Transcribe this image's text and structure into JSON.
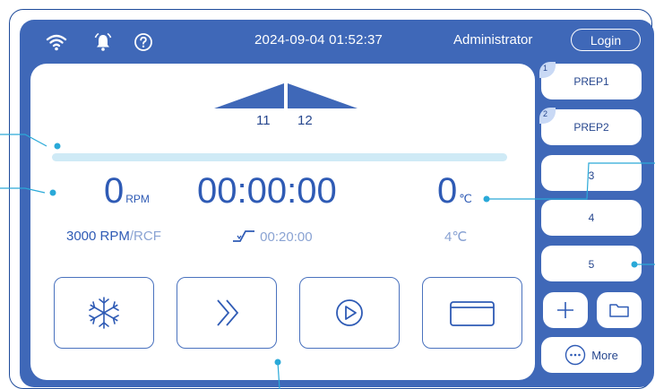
{
  "colors": {
    "screen_bg": "#3f68b8",
    "panel_bg": "#ffffff",
    "accent_blue": "#2f5bb5",
    "progress_track": "#cfeaf6",
    "annotation_line": "#2aa9d8"
  },
  "status_bar": {
    "icons": [
      "wifi-icon",
      "bell-icon",
      "help-icon"
    ],
    "datetime": "2024-09-04 01:52:37",
    "user": "Administrator",
    "login_label": "Login"
  },
  "rotor": {
    "left_slot": "11",
    "right_slot": "12"
  },
  "progress": {
    "fraction": 0.0
  },
  "readouts": {
    "speed_value": "0",
    "speed_unit": "RPM",
    "time_value": "00:00:00",
    "temp_value": "0",
    "temp_unit": "℃",
    "speed_setpoint": "3000 RPM",
    "speed_mode": "/RCF",
    "time_setpoint": "00:20:00",
    "temp_setpoint": "4℃"
  },
  "controls": [
    {
      "icon": "snowflake-icon"
    },
    {
      "icon": "fast-forward-icon"
    },
    {
      "icon": "play-icon"
    },
    {
      "icon": "lid-icon"
    }
  ],
  "programs": [
    {
      "number": "1",
      "label": "PREP1"
    },
    {
      "number": "2",
      "label": "PREP2"
    },
    {
      "number": "",
      "label": "3"
    },
    {
      "number": "",
      "label": "4"
    },
    {
      "number": "",
      "label": "5"
    }
  ],
  "side_tools": {
    "add_icon": "plus-icon",
    "folder_icon": "folder-icon",
    "more_label": "More"
  }
}
